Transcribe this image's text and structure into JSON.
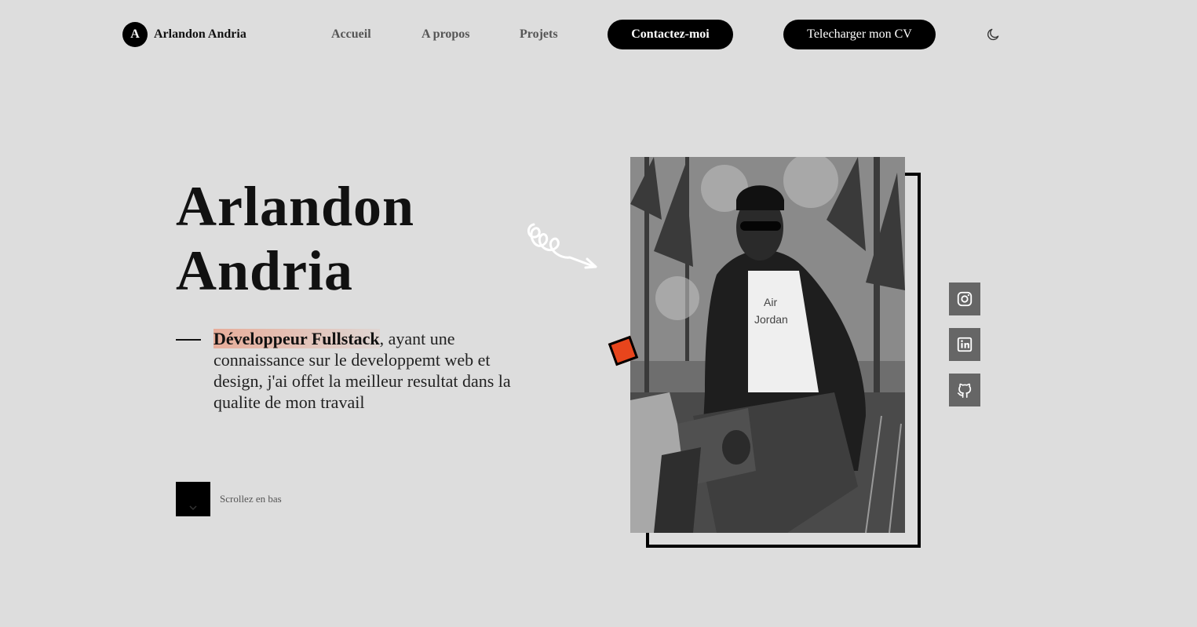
{
  "header": {
    "logo_letter": "A",
    "logo_name": "Arlandon Andria",
    "nav": [
      {
        "label": "Accueil"
      },
      {
        "label": "A propos"
      },
      {
        "label": "Projets"
      }
    ],
    "contact_label": "Contactez-moi",
    "cv_label": "Telecharger mon CV",
    "theme_icon": "moon-icon"
  },
  "hero": {
    "name_line1": "Arlandon",
    "name_line2": "Andria",
    "role": "Développeur Fullstack",
    "description": ", ayant une connaissance sur le developpemt web et design, j'ai offet la meilleur resultat dans la qualite de mon travail",
    "scroll_label": "Scrollez en bas",
    "scroll_icon": "chevron-down-icon"
  },
  "social": [
    {
      "icon": "instagram-icon"
    },
    {
      "icon": "linkedin-icon"
    },
    {
      "icon": "github-icon"
    }
  ],
  "colors": {
    "background": "#dddddd",
    "accent": "#e8451c",
    "highlight": "#e8aa96",
    "dark": "#000000"
  }
}
